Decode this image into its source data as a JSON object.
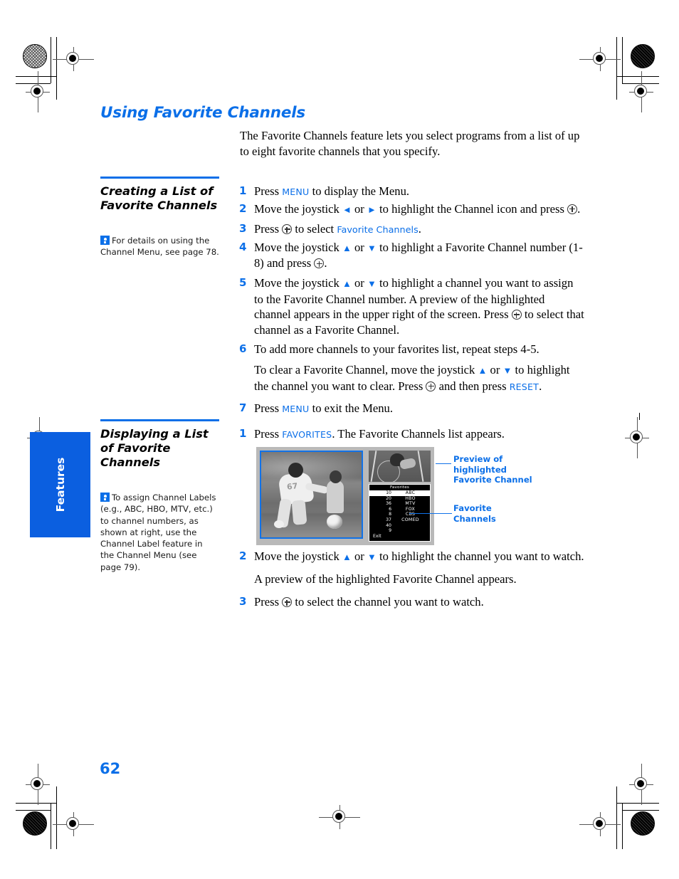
{
  "document": {
    "page_number": "62",
    "section_tab": "Features",
    "title": "Using Favorite Channels",
    "intro": "The Favorite Channels feature lets you select programs from a list of up to eight favorite channels that you specify.",
    "accent_color": "#0b6fe8",
    "tab_color": "#0b5fe0"
  },
  "section_one": {
    "heading_line1": "Creating a List of",
    "heading_line2": "Favorite Channels",
    "tip": {
      "icon": "tip-lightbulb-icon",
      "text": "For details on using the Channel Menu, see page 78."
    },
    "steps": [
      {
        "num": "1",
        "pre": "Press ",
        "key": "MENU",
        "post": " to display the Menu."
      },
      {
        "num": "2",
        "pre": "Move the joystick ",
        "arrows": "left-right",
        "post": " to highlight the Channel icon and press ",
        "tail": "."
      },
      {
        "num": "3",
        "pre": "Press ",
        "post": " to select ",
        "menuitem": "Favorite Channels",
        "tail": "."
      },
      {
        "num": "4",
        "pre": "Move the joystick ",
        "arrows": "up-down",
        "post": " to highlight a Favorite Channel number (1-8) and press ",
        "tail": "."
      },
      {
        "num": "5",
        "pre": "Move the joystick ",
        "arrows": "up-down",
        "post": " to highlight a channel you want to assign to the Favorite Channel number. A preview of the highlighted channel appears in the upper right of the screen. Press ",
        "tail": " to select that channel as a Favorite Channel."
      },
      {
        "num": "6",
        "text": "To add more channels to your favorites list, repeat steps 4-5."
      },
      {
        "num": "7",
        "pre": "Press ",
        "key": "MENU",
        "post": " to exit the Menu."
      }
    ],
    "step6_sub": {
      "pre": "To clear a Favorite Channel, move the joystick ",
      "arrows": "up-down",
      "mid": " to highlight the channel you want to clear. Press ",
      "post": " and then press ",
      "key": "RESET",
      "tail": "."
    }
  },
  "section_two": {
    "heading_line1": "Displaying a List",
    "heading_line2": "of Favorite",
    "heading_line3": "Channels",
    "tip": {
      "icon": "tip-lightbulb-icon",
      "text": "To assign Channel Labels (e.g., ABC, HBO, MTV, etc.) to channel numbers, as shown at right, use the Channel Label feature in the Channel Menu (see page 79)."
    },
    "steps": [
      {
        "num": "1",
        "pre": "Press ",
        "key": "FAVORITES",
        "post": ". The Favorite Channels list appears."
      },
      {
        "num": "2",
        "pre": "Move the joystick ",
        "arrows": "up-down",
        "post": " to highlight the channel you want to watch."
      },
      {
        "num": "3",
        "pre": "Press ",
        "post": " to select the channel you want to watch."
      }
    ],
    "step2_sub": "A preview of the highlighted Favorite Channel appears.",
    "illustration": {
      "photo_alt": "football-player-and-child-photo",
      "preview_alt": "bicycle-preview-thumbnail",
      "favorites_title": "Favorites",
      "favorites_rows": [
        {
          "number": "10",
          "label": "ABC",
          "highlighted": true
        },
        {
          "number": "20",
          "label": "HBO",
          "highlighted": false
        },
        {
          "number": "36",
          "label": "MTV",
          "highlighted": false
        },
        {
          "number": "6",
          "label": "FOX",
          "highlighted": false
        },
        {
          "number": "8",
          "label": "CBS",
          "highlighted": false
        },
        {
          "number": "37",
          "label": "COMED",
          "highlighted": false
        },
        {
          "number": "40",
          "label": "",
          "highlighted": false
        },
        {
          "number": "9",
          "label": "",
          "highlighted": false
        }
      ],
      "exit_label": "Exit",
      "callout_preview": "Preview of highlighted Favorite Channel",
      "callout_favorites": "Favorite Channels"
    }
  }
}
